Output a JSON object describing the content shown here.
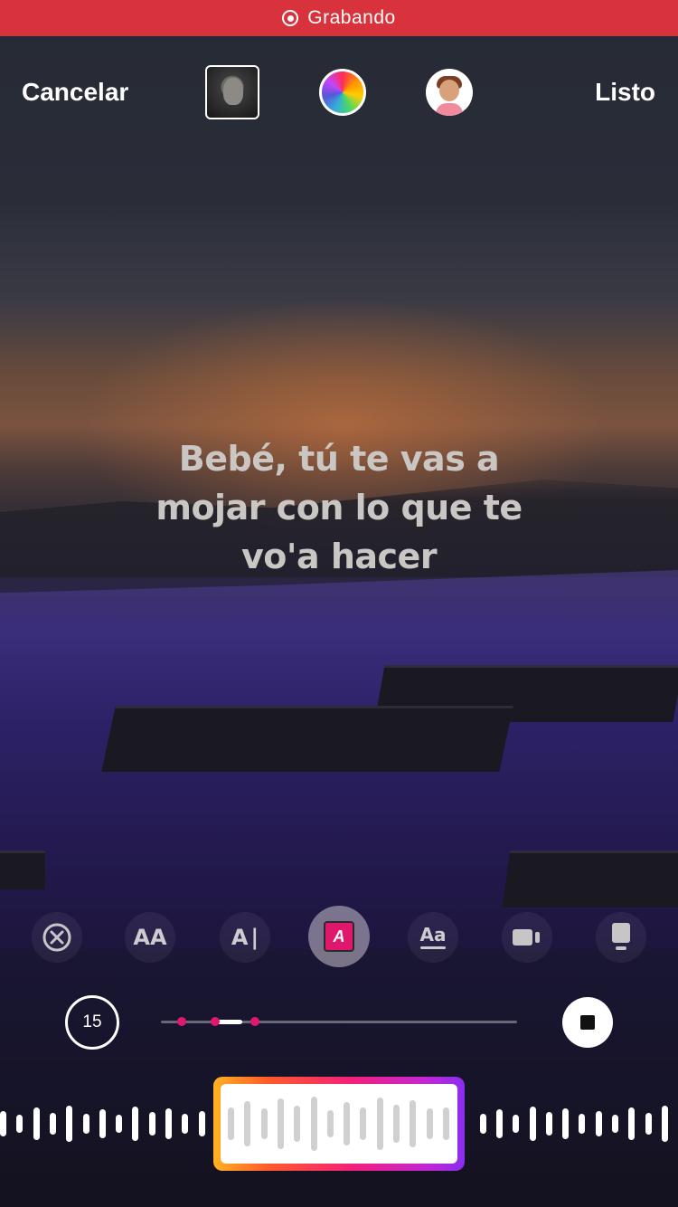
{
  "status_bar": {
    "text": "Grabando",
    "color": "#d8323c",
    "icon": "record-icon"
  },
  "header": {
    "cancel_label": "Cancelar",
    "done_label": "Listo",
    "album_cover": {
      "icon": "album-cover"
    },
    "color_picker": {
      "icon": "color-wheel-icon"
    },
    "avatar": {
      "icon": "avatar-icon"
    }
  },
  "lyrics": {
    "lines": [
      "Bebé, tú te vas a",
      "mojar con lo que te",
      "vo'a hacer"
    ]
  },
  "toolbar": {
    "items": [
      {
        "icon": "remove-circle-icon",
        "label": ""
      },
      {
        "icon": "text-size-icon",
        "label": "AA"
      },
      {
        "icon": "text-cursor-icon",
        "label": "A"
      },
      {
        "icon": "text-highlight-icon",
        "label": "A",
        "active": true
      },
      {
        "icon": "text-style-icon",
        "label": "Aa"
      },
      {
        "icon": "video-icon",
        "label": ""
      },
      {
        "icon": "sticker-icon",
        "label": ""
      }
    ]
  },
  "player": {
    "duration_label": "15",
    "accent_color": "#e0186d",
    "stop_icon": "stop-icon"
  }
}
